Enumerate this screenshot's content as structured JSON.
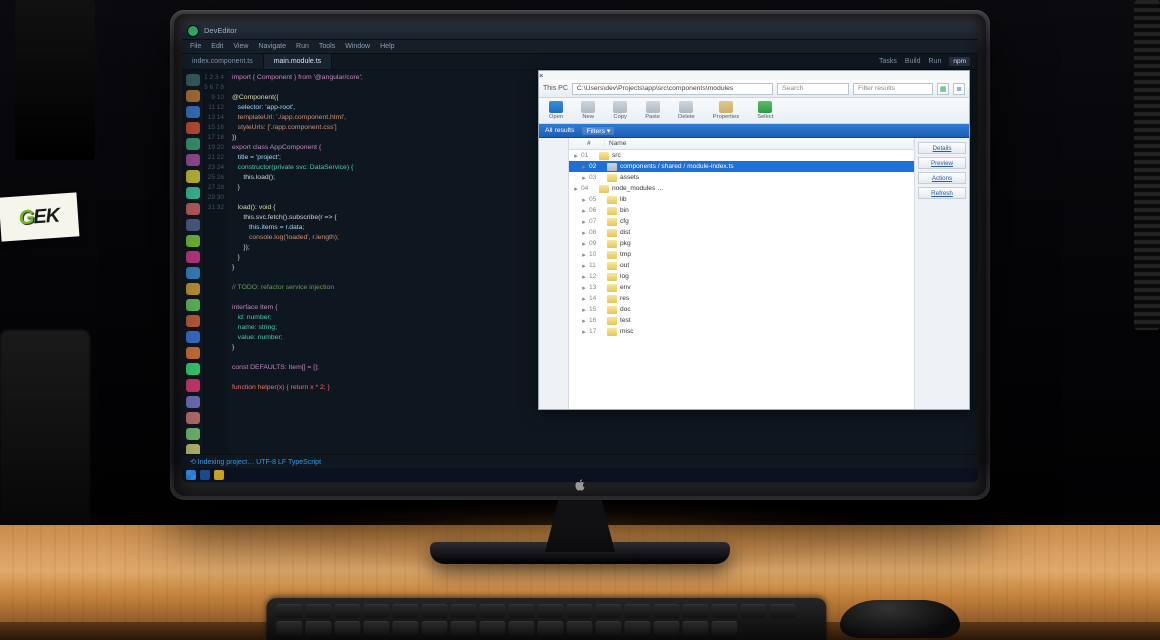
{
  "scene": {
    "sticker_text_left": "G",
    "sticker_text_right": "EK"
  },
  "ide": {
    "title": "DevEditor",
    "menu": [
      "File",
      "Edit",
      "View",
      "Navigate",
      "Run",
      "Tools",
      "Window",
      "Help"
    ],
    "tabs": [
      {
        "label": "index.component.ts",
        "active": false
      },
      {
        "label": "main.module.ts",
        "active": true
      }
    ],
    "right_chips": [
      "Tasks",
      "Build",
      "Run"
    ],
    "right_badge": "npm",
    "status": "⟲  Indexing project…  UTF-8  LF  TypeScript",
    "line_start": 1,
    "code_lines": [
      {
        "t": "import { Component } from '@angular/core';",
        "cls": "kw"
      },
      {
        "t": "",
        "cls": ""
      },
      {
        "t": "@Component({",
        "cls": "fn"
      },
      {
        "t": "   selector: 'app-root',",
        "cls": "prop"
      },
      {
        "t": "   templateUrl: './app.component.html',",
        "cls": "str"
      },
      {
        "t": "   styleUrls: ['./app.component.css']",
        "cls": "str"
      },
      {
        "t": "})",
        "cls": "fn"
      },
      {
        "t": "export class AppComponent {",
        "cls": "kw"
      },
      {
        "t": "   title = 'project';",
        "cls": "prop"
      },
      {
        "t": "   constructor(private svc: DataService) {",
        "cls": "type"
      },
      {
        "t": "      this.load();",
        "cls": "op"
      },
      {
        "t": "   }",
        "cls": "op"
      },
      {
        "t": "",
        "cls": ""
      },
      {
        "t": "   load(): void {",
        "cls": "fn"
      },
      {
        "t": "      this.svc.fetch().subscribe(r => {",
        "cls": "op"
      },
      {
        "t": "         this.items = r.data;",
        "cls": "prop"
      },
      {
        "t": "         console.log('loaded', r.length);",
        "cls": "str"
      },
      {
        "t": "      });",
        "cls": "op"
      },
      {
        "t": "   }",
        "cls": "op"
      },
      {
        "t": "}",
        "cls": "op"
      },
      {
        "t": "",
        "cls": ""
      },
      {
        "t": "// TODO: refactor service injection",
        "cls": "cm"
      },
      {
        "t": "",
        "cls": ""
      },
      {
        "t": "interface Item {",
        "cls": "kw"
      },
      {
        "t": "   id: number;",
        "cls": "type"
      },
      {
        "t": "   name: string;",
        "cls": "type"
      },
      {
        "t": "   value: number;",
        "cls": "type"
      },
      {
        "t": "}",
        "cls": "op"
      },
      {
        "t": "",
        "cls": ""
      },
      {
        "t": "const DEFAULTS: Item[] = [];",
        "cls": "kw"
      },
      {
        "t": "",
        "cls": ""
      },
      {
        "t": "function helper(x) { return x * 2; }",
        "cls": "err"
      }
    ]
  },
  "explorer": {
    "crumb_label": "This PC",
    "address": "C:\\Users\\dev\\Projects\\app\\src\\components\\modules",
    "search_placeholder": "Search",
    "search_box2": "Filter results",
    "toolbar": [
      {
        "label": "Open",
        "ic": "ic-blue"
      },
      {
        "label": "New",
        "ic": "ic-gray"
      },
      {
        "label": "Copy",
        "ic": "ic-gray"
      },
      {
        "label": "Paste",
        "ic": "ic-gray"
      },
      {
        "label": "Delete",
        "ic": "ic-gray"
      },
      {
        "label": "Properties",
        "ic": "ic-tan"
      },
      {
        "label": "Select",
        "ic": "ic-green"
      }
    ],
    "filter_label": "All results",
    "filter_pill": "Filters ▾",
    "columns": [
      "",
      "#",
      "Name"
    ],
    "side_buttons": [
      "Details",
      "Preview",
      "Actions",
      "Refresh"
    ],
    "rows": [
      {
        "n": "01",
        "name": "src",
        "sel": false,
        "folder": true,
        "indent": 0
      },
      {
        "n": "02",
        "name": "components / shared / module-index.ts",
        "sel": true,
        "folder": false,
        "indent": 1
      },
      {
        "n": "03",
        "name": "assets",
        "sel": false,
        "folder": true,
        "indent": 1
      },
      {
        "n": "04",
        "name": "node_modules …",
        "sel": false,
        "folder": true,
        "indent": 0
      },
      {
        "n": "05",
        "name": "lib",
        "sel": false,
        "folder": true,
        "indent": 1
      },
      {
        "n": "06",
        "name": "bin",
        "sel": false,
        "folder": true,
        "indent": 1
      },
      {
        "n": "07",
        "name": "cfg",
        "sel": false,
        "folder": true,
        "indent": 1
      },
      {
        "n": "08",
        "name": "dist",
        "sel": false,
        "folder": true,
        "indent": 1
      },
      {
        "n": "09",
        "name": "pkg",
        "sel": false,
        "folder": true,
        "indent": 1
      },
      {
        "n": "10",
        "name": "tmp",
        "sel": false,
        "folder": true,
        "indent": 1
      },
      {
        "n": "11",
        "name": "out",
        "sel": false,
        "folder": true,
        "indent": 1
      },
      {
        "n": "12",
        "name": "log",
        "sel": false,
        "folder": true,
        "indent": 1
      },
      {
        "n": "13",
        "name": "env",
        "sel": false,
        "folder": true,
        "indent": 1
      },
      {
        "n": "14",
        "name": "res",
        "sel": false,
        "folder": true,
        "indent": 1
      },
      {
        "n": "15",
        "name": "doc",
        "sel": false,
        "folder": true,
        "indent": 1
      },
      {
        "n": "16",
        "name": "test",
        "sel": false,
        "folder": true,
        "indent": 1
      },
      {
        "n": "17",
        "name": "misc",
        "sel": false,
        "folder": true,
        "indent": 1
      }
    ]
  }
}
